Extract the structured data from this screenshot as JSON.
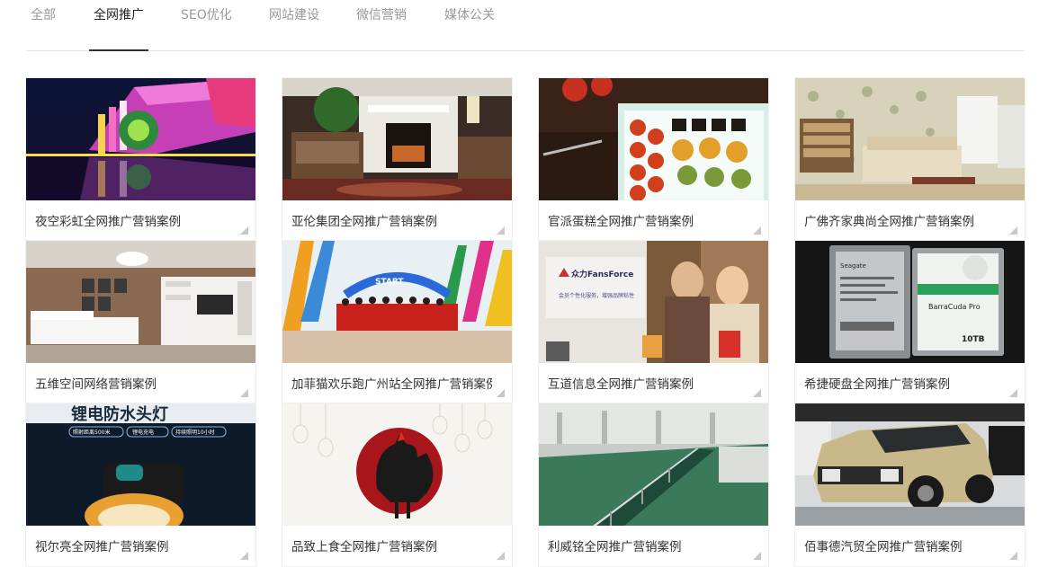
{
  "tabs": [
    {
      "label": "全部",
      "active": false
    },
    {
      "label": "全网推广",
      "active": true
    },
    {
      "label": "SEO优化",
      "active": false
    },
    {
      "label": "网站建设",
      "active": false
    },
    {
      "label": "微信营销",
      "active": false
    },
    {
      "label": "媒体公关",
      "active": false
    }
  ],
  "cases": [
    {
      "title": "夜空彩虹全网推广营销案例",
      "image": "night-rainbow-building"
    },
    {
      "title": "亚伦集团全网推广营销案例",
      "image": "fireplace-living-room"
    },
    {
      "title": "官派蛋糕全网推广营销案例",
      "image": "cake-box"
    },
    {
      "title": "广佛齐家典尚全网推广营销案例",
      "image": "floral-living-room"
    },
    {
      "title": "五维空间网络营销案例",
      "image": "modern-living-room"
    },
    {
      "title": "加菲猫欢乐跑广州站全网推广营销案例",
      "image": "fun-run-crowd"
    },
    {
      "title": "互道信息全网推广营销案例",
      "image": "shopping-women"
    },
    {
      "title": "希捷硬盘全网推广营销案例",
      "image": "hard-drives"
    },
    {
      "title": "视尔亮全网推广营销案例",
      "image": "headlamp"
    },
    {
      "title": "品致上食全网推广营销案例",
      "image": "rooster-papercut"
    },
    {
      "title": "利威铭全网推广营销案例",
      "image": "factory-conveyor"
    },
    {
      "title": "佰事德汽贸全网推广营销案例",
      "image": "toyota-suv"
    }
  ],
  "overlay_text": {
    "start_banner": "START",
    "fansforce_brand": "众力FansForce",
    "fansforce_tagline": "会员个性化服务，增强品牌粘性",
    "hd_brand": "Seagate",
    "hd_model": "BarraCuda Pro",
    "hd_capacity": "10TB",
    "headlamp_headline": "锂电防水头灯",
    "headlamp_tag1": "照射距离500米",
    "headlamp_tag2": "锂电充电",
    "headlamp_tag3": "持续照明10小时"
  },
  "colors": {
    "active_tab": "#222222",
    "inactive_tab": "#999999",
    "caption": "#333333",
    "corner": "#c8c8c8"
  }
}
